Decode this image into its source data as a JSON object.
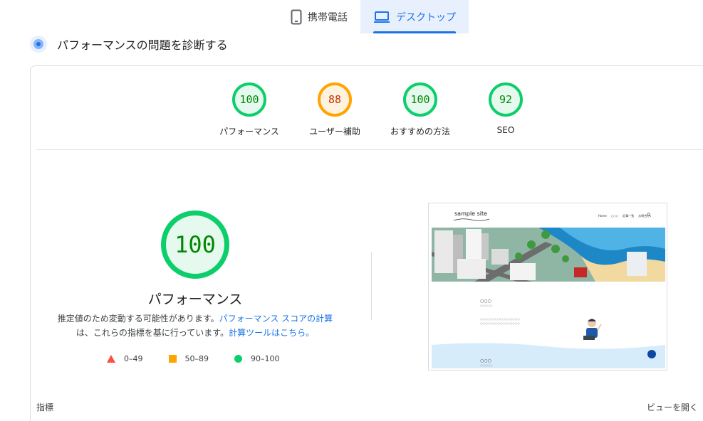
{
  "tabs": [
    {
      "label": "携帯電話",
      "icon": "smartphone-icon",
      "active": false
    },
    {
      "label": "デスクトップ",
      "icon": "laptop-icon",
      "active": true
    }
  ],
  "diagnose": {
    "title": "パフォーマンスの問題を診断する"
  },
  "gauges": [
    {
      "score": "100",
      "label": "パフォーマンス",
      "rating": "pass"
    },
    {
      "score": "88",
      "label": "ユーザー補助",
      "rating": "average"
    },
    {
      "score": "100",
      "label": "おすすめの方法",
      "rating": "pass"
    },
    {
      "score": "92",
      "label": "SEO",
      "rating": "pass"
    }
  ],
  "main_gauge": {
    "score": "100",
    "title": "パフォーマンス"
  },
  "description": {
    "text1": "推定値のため変動する可能性があります。",
    "link1": "パフォーマンス スコアの計算",
    "text2": "は、これらの指標を基に行っています。",
    "link2": "計算ツールはこちら。"
  },
  "legend": [
    {
      "range": "0–49",
      "shape": "triangle",
      "color": "#ff4e42"
    },
    {
      "range": "50–89",
      "shape": "square",
      "color": "#ffa400"
    },
    {
      "range": "90–100",
      "shape": "circle",
      "color": "#0cce6b"
    }
  ],
  "screenshot": {
    "site_title": "sample site",
    "nav": [
      "Home",
      "○○○",
      "記事一覧",
      "お問合せ"
    ],
    "block1_title": "○○○",
    "block1_sub": "○○○○○",
    "block1_line1": "○○○○○○○○○○○○○○○○",
    "block1_line2": "○○○○○○○○○○○○○○○○",
    "block2_title": "○○○",
    "block2_sub": "○○○○○"
  },
  "footer": {
    "metrics_label": "指標",
    "expand_label": "ビューを開く"
  },
  "colors": {
    "pass": "#0cce6b",
    "average": "#ffa400",
    "fail": "#ff4e42",
    "accent": "#1a73e8"
  }
}
